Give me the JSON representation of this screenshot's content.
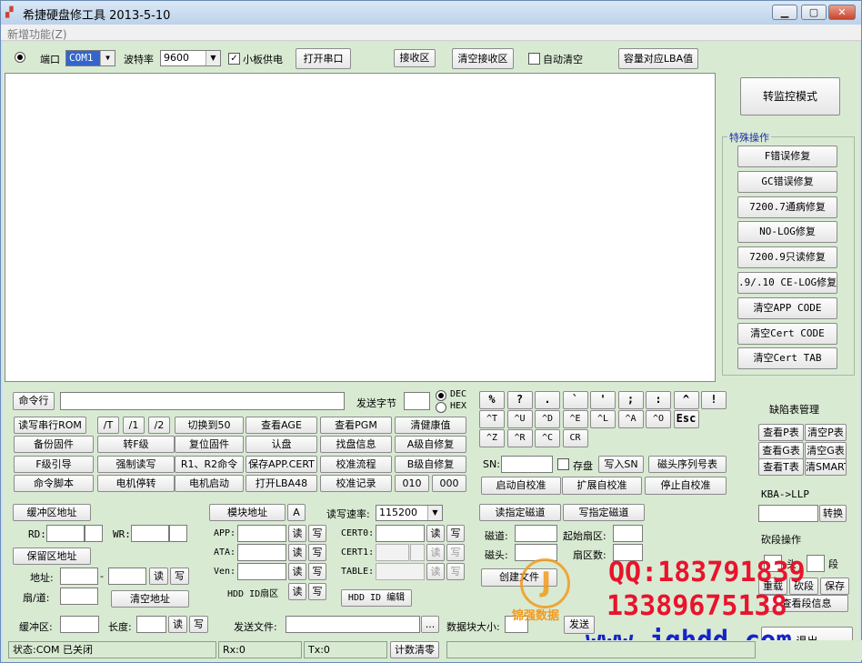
{
  "window": {
    "title": "希捷硬盘修工具 2013-5-10",
    "menu": "新增功能(Z)",
    "min": "▁",
    "max": "▢",
    "close": "✕"
  },
  "row1": {
    "port_label": "端口",
    "port_value": "COM1",
    "baud_label": "波特率",
    "baud_value": "9600",
    "small_board_power": "小板供电",
    "open_port": "打开串口",
    "recv_area": "接收区",
    "clear_recv": "清空接收区",
    "auto_clear": "自动清空",
    "capacity_lba": "容量对应LBA值"
  },
  "right_panel": {
    "monitor_mode": "转监控模式",
    "special_ops_title": "特殊操作",
    "special_ops": [
      "F错误修复",
      "GC错误修复",
      "7200.7通病修复",
      "NO-LOG修复",
      "7200.9只读修复",
      ".9/.10 CE-LOG修复",
      "清空APP CODE",
      "清空Cert CODE",
      "清空Cert TAB"
    ]
  },
  "cmd": {
    "cmd_label": "命令行",
    "send_bytes": "发送字节",
    "dec": "DEC",
    "hex": "HEX"
  },
  "grid": [
    [
      "读写串行ROM",
      "/T",
      "/1",
      "/2",
      "切换到50",
      "查看AGE",
      "查看PGM",
      "清健康值"
    ],
    [
      "备份固件",
      "转F级",
      "复位固件",
      "认盘",
      "找盘信息",
      "A级自修复"
    ],
    [
      "F级引导",
      "强制读写",
      "R1、R2命令",
      "保存APP.CERT",
      "校准流程",
      "B级自修复"
    ],
    [
      "命令脚本",
      "电机停转",
      "电机启动",
      "打开LBA48",
      "校准记录",
      "010",
      "000"
    ]
  ],
  "keys_row1": [
    "%",
    "?",
    ".",
    "`",
    "'",
    ";",
    ":",
    "^",
    "!"
  ],
  "keys_row2": [
    "^T",
    "^U",
    "^D",
    "^E",
    "^L",
    "^A",
    "^O",
    "Esc"
  ],
  "keys_row3": [
    "^Z",
    "^R",
    "^C",
    "CR"
  ],
  "sn": {
    "label": "SN:",
    "store": "存盘",
    "write_sn": "写入SN",
    "serial_table": "磁头序列号表"
  },
  "selfcal": {
    "start": "启动自校准",
    "extend": "扩展自校准",
    "stop": "停止自校准"
  },
  "defect": {
    "title": "缺陷表管理",
    "view_p": "查看P表",
    "clear_p": "清空P表",
    "view_g": "查看G表",
    "clear_g": "清空G表",
    "view_t": "查看T表",
    "clear_smart": "清SMART",
    "kba": "KBA->LLP",
    "convert": "转换",
    "cut_title": "砍段操作",
    "head": "头",
    "seg": "段",
    "re_cut": "重载",
    "cut": "砍段",
    "save": "保存",
    "view_info": "查看段信息"
  },
  "buffer": {
    "buffer_addr": "缓冲区地址",
    "rd": "RD:",
    "wr": "WR:",
    "reserve_addr": "保留区地址",
    "addr": "地址:",
    "dash": "-",
    "read": "读",
    "write": "写",
    "sector_track": "扇/道:",
    "clear_addr": "清空地址",
    "buffer_area": "缓冲区:",
    "length": "长度:"
  },
  "module": {
    "module_addr": "模块地址",
    "a": "A",
    "app": "APP:",
    "ata": "ATA:",
    "ven": "Ven:",
    "hdd_id_sector": "HDD ID扇区",
    "read": "读",
    "write": "写",
    "rw_speed": "读写速率:",
    "speed_value": "115200",
    "cert0": "CERT0:",
    "cert1": "CERT1:",
    "table": "TABLE:",
    "hdd_id_edit": "HDD ID 编辑"
  },
  "track": {
    "read_track": "读指定磁道",
    "write_track": "写指定磁道",
    "track_label": "磁道:",
    "start_sector": "起始扇区:",
    "head_label": "磁头:",
    "sector_count": "扇区数:",
    "create_file": "创建文件"
  },
  "send": {
    "send_file": "发送文件:",
    "browse": "...",
    "block_size": "数据块大小:",
    "send": "发送"
  },
  "status": {
    "state": "状态:COM 已关闭",
    "rx": "Rx:0",
    "tx": "Tx:0",
    "clear_count": "计数清零",
    "exit": "退出"
  },
  "watermark": {
    "qq": "QQ:183791839",
    "phone": "13389675138",
    "url": "www.jqhdd.com",
    "logo_text": "锦强数据"
  },
  "colors": {
    "client": "#d9ead3",
    "watermark_red": "#e8142c",
    "watermark_blue": "#1624c8"
  }
}
